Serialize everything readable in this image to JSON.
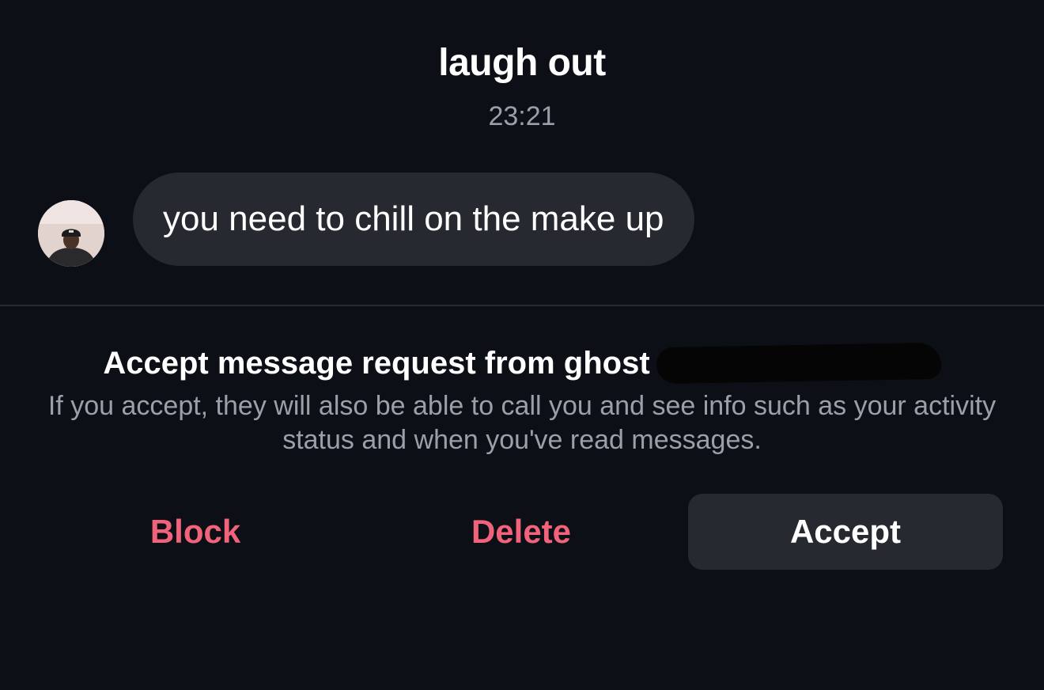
{
  "header": {
    "title": "laugh out",
    "timestamp": "23:21"
  },
  "message": {
    "text": "you need to chill on the make up"
  },
  "request": {
    "title": "Accept message request from ghost",
    "description": "If you accept, they will also be able to call you and see info such as your activity status and when you've read messages."
  },
  "actions": {
    "block_label": "Block",
    "delete_label": "Delete",
    "accept_label": "Accept"
  },
  "colors": {
    "background": "#0c0f16",
    "bubble": "#262930",
    "destructive": "#f0637a",
    "muted_text": "#9aa0aa"
  }
}
